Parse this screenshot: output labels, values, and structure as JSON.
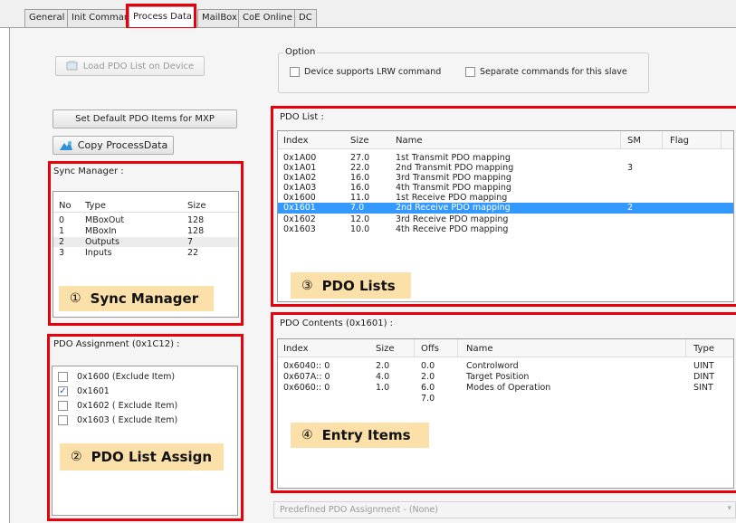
{
  "tabs": [
    "General",
    "Init Commands",
    "Process Data",
    "MailBox",
    "CoE Online",
    "DC"
  ],
  "buttons": {
    "load_pdo": "Load PDO List on Device",
    "set_default": "Set Default PDO Items for MXP",
    "copy_process": "Copy ProcessData"
  },
  "option": {
    "label": "Option",
    "lrw": "Device supports LRW command",
    "separate": "Separate commands for this slave"
  },
  "sync_manager": {
    "label": "Sync Manager :",
    "columns": [
      "No",
      "Type",
      "Size"
    ],
    "rows": [
      {
        "no": "0",
        "type": "MBoxOut",
        "size": "128"
      },
      {
        "no": "1",
        "type": "MBoxIn",
        "size": "128"
      },
      {
        "no": "2",
        "type": "Outputs",
        "size": "7"
      },
      {
        "no": "3",
        "type": "Inputs",
        "size": "22"
      }
    ]
  },
  "pdo_assignment": {
    "label": "PDO Assignment (0x1C12) :",
    "items": [
      {
        "text": "0x1600 (Exclude Item)",
        "checked": false
      },
      {
        "text": "0x1601",
        "checked": true
      },
      {
        "text": "0x1602 ( Exclude Item)",
        "checked": false
      },
      {
        "text": "0x1603 ( Exclude Item)",
        "checked": false
      }
    ]
  },
  "pdo_list": {
    "label": "PDO List :",
    "columns": [
      "Index",
      "Size",
      "Name",
      "SM",
      "Flag"
    ],
    "rows": [
      {
        "index": "0x1A00",
        "size": "27.0",
        "name": "1st Transmit PDO mapping",
        "sm": ""
      },
      {
        "index": "0x1A01",
        "size": "22.0",
        "name": "2nd Transmit PDO mapping",
        "sm": "3"
      },
      {
        "index": "0x1A02",
        "size": "16.0",
        "name": "3rd Transmit PDO mapping",
        "sm": ""
      },
      {
        "index": "0x1A03",
        "size": "16.0",
        "name": "4th Transmit PDO mapping",
        "sm": ""
      },
      {
        "index": "0x1600",
        "size": "11.0",
        "name": "1st Receive PDO mapping",
        "sm": ""
      },
      {
        "index": "0x1601",
        "size": "7.0",
        "name": "2nd Receive PDO mapping",
        "sm": "2"
      },
      {
        "index": "0x1602",
        "size": "12.0",
        "name": "3rd Receive PDO mapping",
        "sm": ""
      },
      {
        "index": "0x1603",
        "size": "10.0",
        "name": "4th Receive PDO mapping",
        "sm": ""
      }
    ]
  },
  "pdo_contents": {
    "label": "PDO Contents (0x1601) :",
    "columns": [
      "Index",
      "Size",
      "Offs",
      "Name",
      "Type"
    ],
    "rows": [
      {
        "index": "0x6040:: 0",
        "size": "2.0",
        "offs": "0.0",
        "name": "Controlword",
        "type": "UINT"
      },
      {
        "index": "0x607A:: 0",
        "size": "4.0",
        "offs": "2.0",
        "name": "Target Position",
        "type": "DINT"
      },
      {
        "index": "0x6060:: 0",
        "size": "1.0",
        "offs": "6.0",
        "name": "Modes of Operation",
        "type": "SINT"
      },
      {
        "index": "",
        "size": "",
        "offs": "7.0",
        "name": "",
        "type": ""
      }
    ]
  },
  "predefined": "Predefined PDO Assignment - (None)",
  "callouts": [
    {
      "num": "①",
      "text": "Sync Manager"
    },
    {
      "num": "②",
      "text": "PDO List Assign"
    },
    {
      "num": "③",
      "text": "PDO Lists"
    },
    {
      "num": "④",
      "text": "Entry Items"
    }
  ],
  "colors": {
    "highlight": "#3399ff",
    "callout_red": "#e8000b",
    "callout_fill": "#fbe0a9"
  }
}
